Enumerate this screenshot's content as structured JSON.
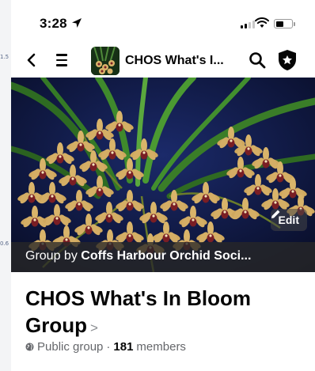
{
  "background": {
    "side_numbers": [
      "1.5",
      "0.6"
    ]
  },
  "status_bar": {
    "time": "3:28",
    "icons": [
      "location-arrow-icon",
      "cellular-signal-icon",
      "wifi-icon",
      "battery-icon"
    ]
  },
  "nav": {
    "title": "CHOS What's I...",
    "icons": [
      "back-chevron-icon",
      "hamburger-menu-icon",
      "search-icon",
      "admin-shield-icon"
    ]
  },
  "cover": {
    "edit_label": "Edit",
    "caption_prefix": "Group by",
    "caption_owner": "Coffs Harbour Orchid Soci..."
  },
  "group": {
    "name": "CHOS What's In Bloom Group",
    "chevron": ">",
    "privacy": "Public group",
    "separator": "·",
    "member_count": "181",
    "members_label": "members"
  },
  "colors": {
    "text_primary": "#050505",
    "text_secondary": "#65676b",
    "cover_background": "#0b1230",
    "orchid_petal": "#d9b46a",
    "orchid_lip": "#7a1e24"
  }
}
